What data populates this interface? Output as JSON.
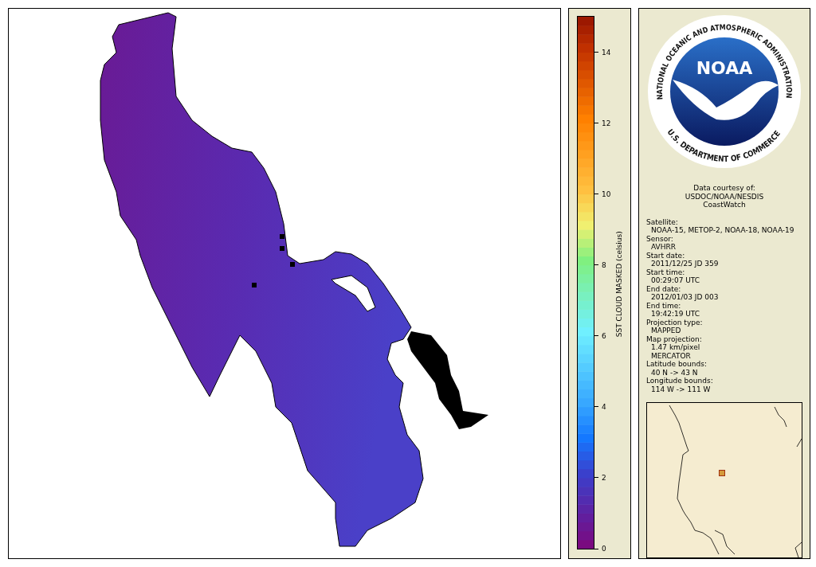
{
  "legend": {
    "title": "SST CLOUD MASKED (celsius)",
    "ticks": [
      "14",
      "12",
      "10",
      "8",
      "6",
      "4",
      "2",
      "0"
    ]
  },
  "logo": {
    "top_text": "NATIONAL OCEANIC AND ATMOSPHERIC ADMINISTRATION",
    "bottom_text": "U.S. DEPARTMENT OF COMMERCE",
    "center_text": "NOAA"
  },
  "credit": [
    "Data courtesy of:",
    "USDOC/NOAA/NESDIS",
    "CoastWatch"
  ],
  "info": [
    {
      "label": "Satellite:",
      "values": [
        "NOAA-15, METOP-2, NOAA-18, NOAA-19"
      ]
    },
    {
      "label": "Sensor:",
      "values": [
        "AVHRR"
      ]
    },
    {
      "label": "Start date:",
      "values": [
        "2011/12/25 JD 359"
      ]
    },
    {
      "label": "Start time:",
      "values": [
        "00:29:07 UTC"
      ]
    },
    {
      "label": "End date:",
      "values": [
        "2012/01/03 JD 003"
      ]
    },
    {
      "label": "End time:",
      "values": [
        "19:42:19 UTC"
      ]
    },
    {
      "label": "Projection type:",
      "values": [
        "MAPPED"
      ]
    },
    {
      "label": "Map projection:",
      "values": [
        "1.47 km/pixel",
        "MERCATOR"
      ]
    },
    {
      "label": "Latitude bounds:",
      "values": [
        "40 N -> 43 N"
      ]
    },
    {
      "label": "Longitude bounds:",
      "values": [
        "114 W -> 111 W"
      ]
    }
  ]
}
